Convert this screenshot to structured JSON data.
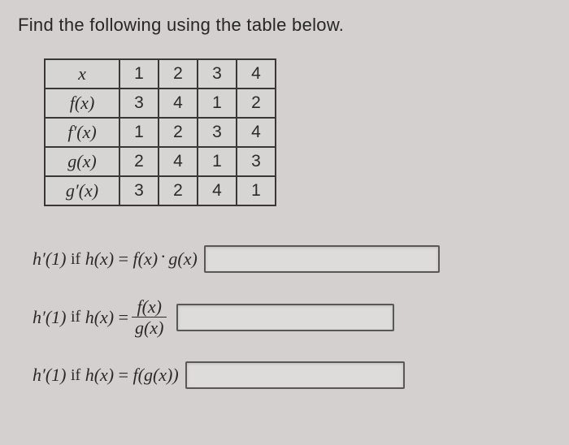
{
  "prompt": "Find the following using the table below.",
  "table": {
    "header_var": "x",
    "cols": [
      "1",
      "2",
      "3",
      "4"
    ],
    "rows": [
      {
        "label": "f(x)",
        "cells": [
          "3",
          "4",
          "1",
          "2"
        ]
      },
      {
        "label": "f′(x)",
        "cells": [
          "1",
          "2",
          "3",
          "4"
        ]
      },
      {
        "label": "g(x)",
        "cells": [
          "2",
          "4",
          "1",
          "3"
        ]
      },
      {
        "label": "g′(x)",
        "cells": [
          "3",
          "2",
          "4",
          "1"
        ]
      }
    ]
  },
  "questions": {
    "q1": {
      "lhs": "h′(1)",
      "word": "if",
      "rhs_left": "h(x)",
      "eq": "=",
      "rhs_right_a": "f(x)",
      "dot": "·",
      "rhs_right_b": "g(x)"
    },
    "q2": {
      "lhs": "h′(1)",
      "word": "if",
      "rhs_left": "h(x)",
      "eq": "=",
      "frac_num": "f(x)",
      "frac_den": "g(x)"
    },
    "q3": {
      "lhs": "h′(1)",
      "word": "if",
      "rhs_left": "h(x)",
      "eq": "=",
      "rhs_right": "f(g(x))"
    }
  }
}
